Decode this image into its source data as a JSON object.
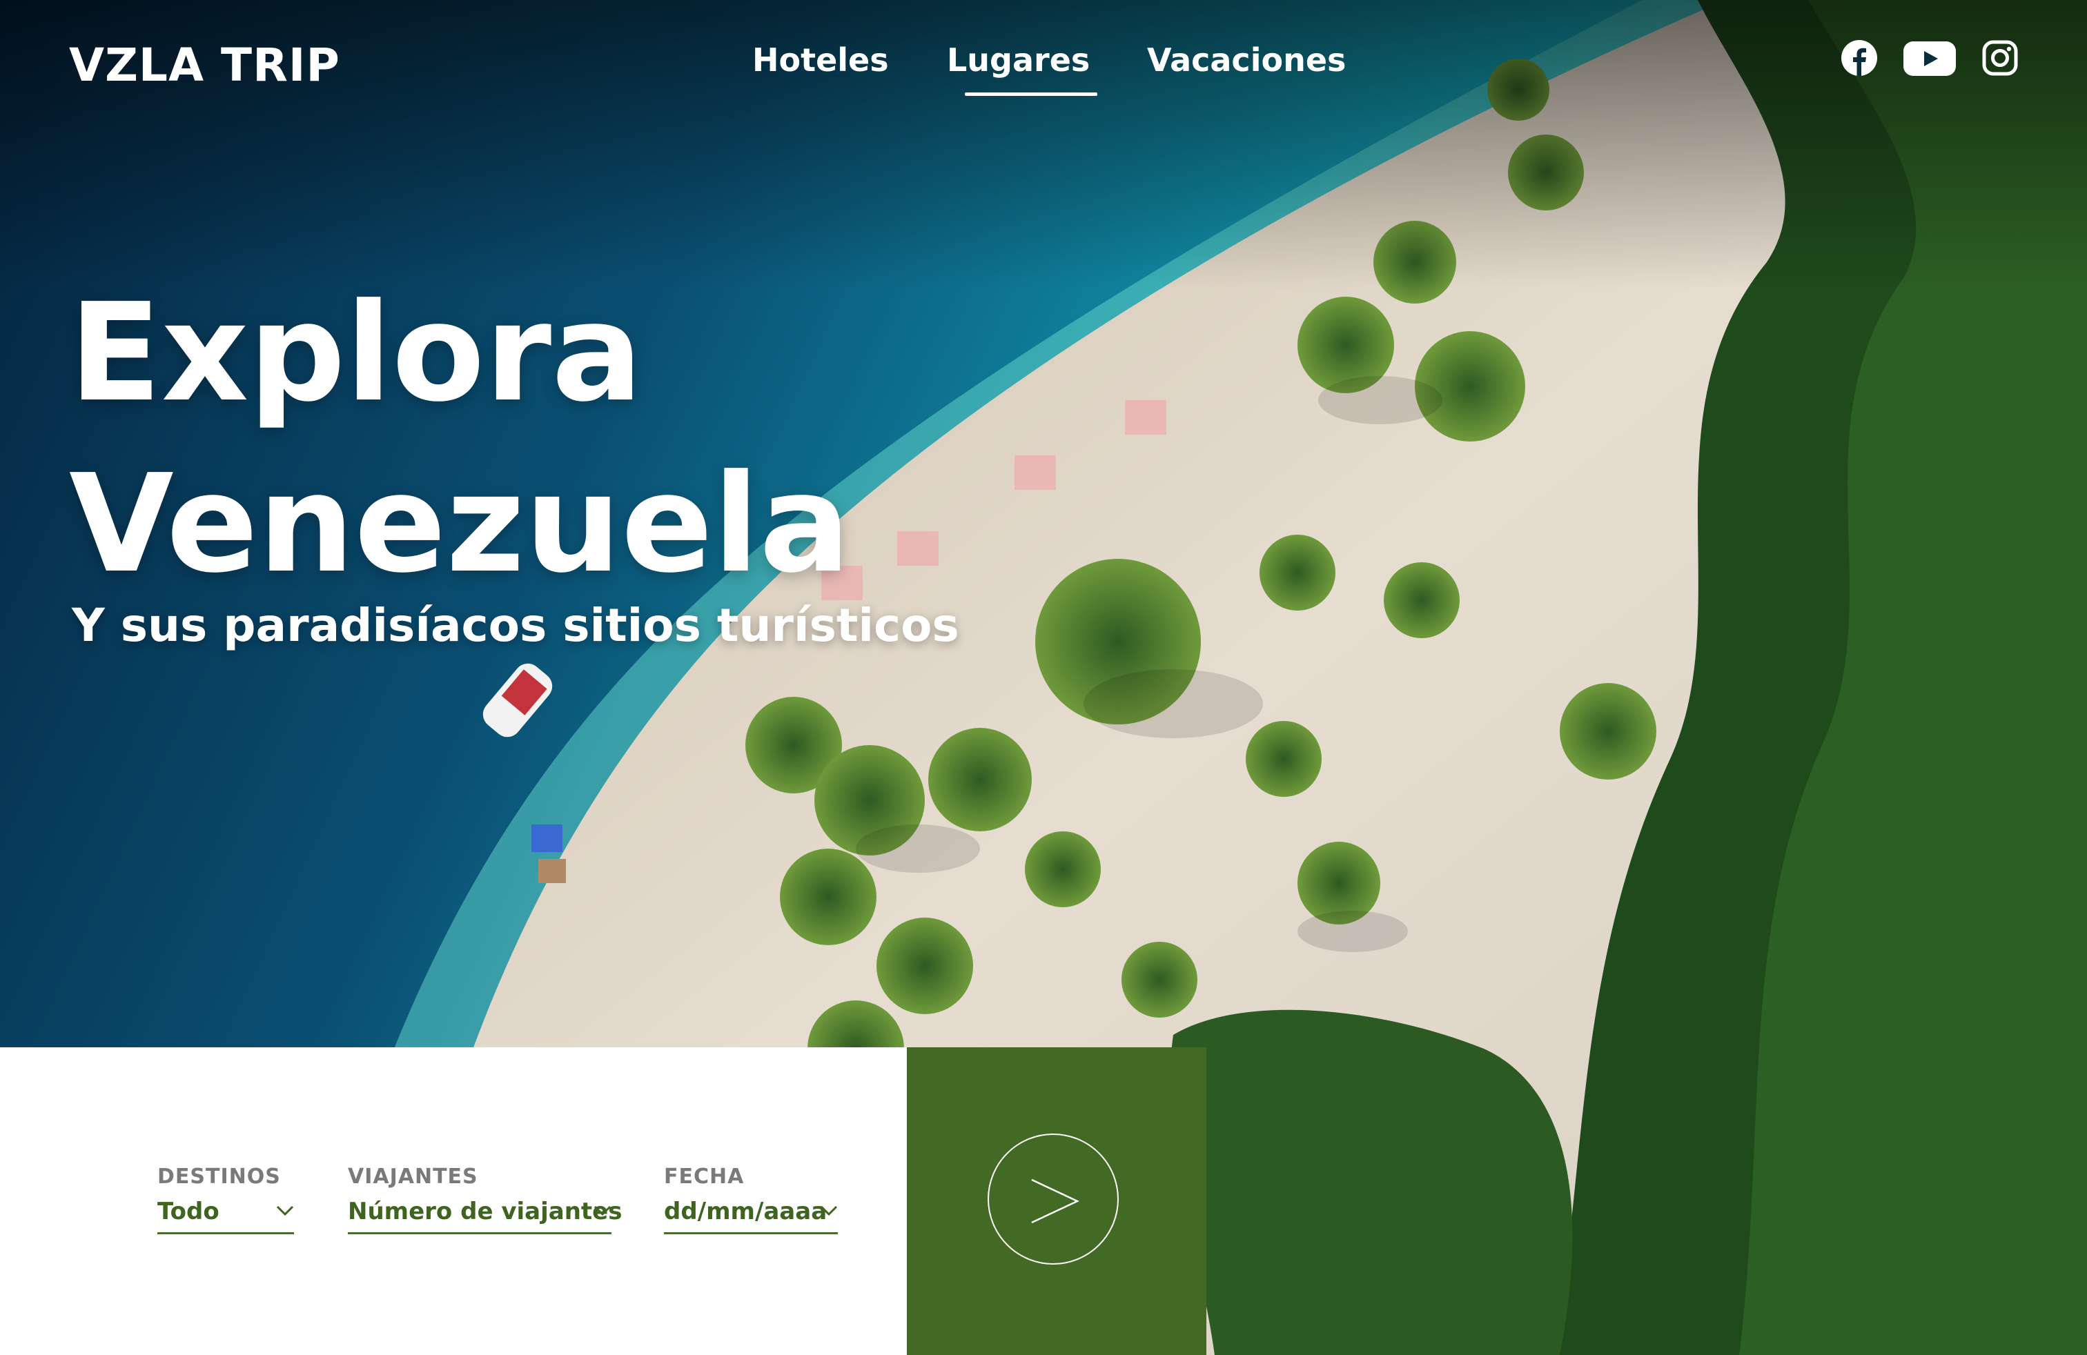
{
  "brand": {
    "logo": "VZLA TRIP"
  },
  "nav": {
    "items": [
      {
        "label": "Hoteles",
        "active": false
      },
      {
        "label": "Lugares",
        "active": true
      },
      {
        "label": "Vacaciones",
        "active": false
      }
    ]
  },
  "social": {
    "icons": [
      "facebook-icon",
      "youtube-icon",
      "instagram-icon"
    ]
  },
  "hero": {
    "headline_line1": "Explora",
    "headline_line2": "Venezuela",
    "subtitle": "Y sus paradisíacos sitios turísticos"
  },
  "search": {
    "destinos": {
      "label": "DESTINOS",
      "value": "Todo"
    },
    "viajantes": {
      "label": "VIAJANTES",
      "value": "Número de viajantes"
    },
    "fecha": {
      "label": "FECHA",
      "value": "dd/mm/aaaa"
    },
    "submit_icon": "arrow-right-icon"
  },
  "colors": {
    "accent_green": "#436a25",
    "field_text": "#3f6420",
    "label_gray": "#7a7a7a"
  }
}
